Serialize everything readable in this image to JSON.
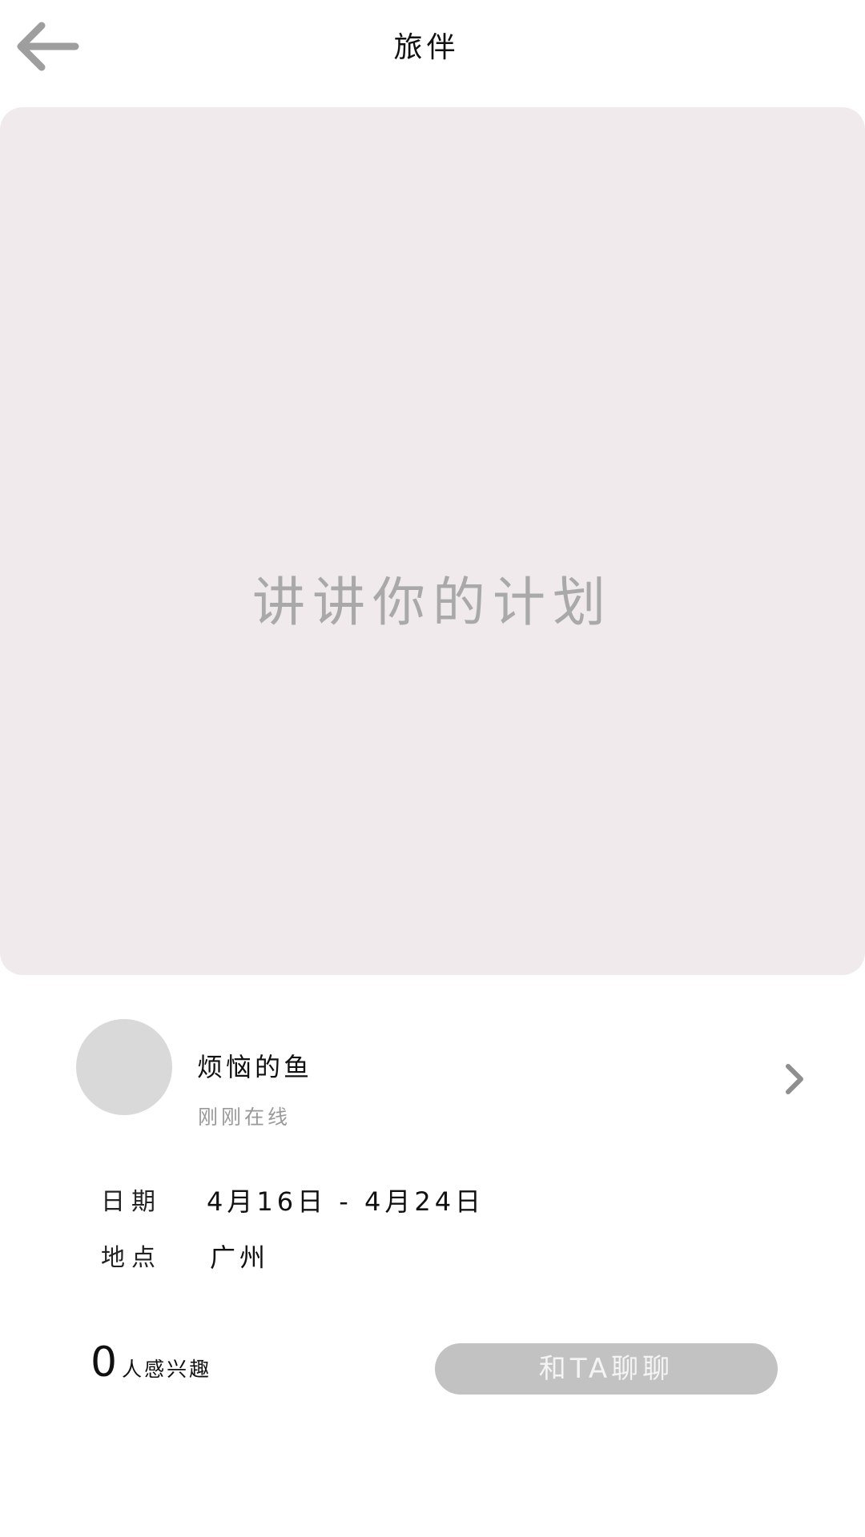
{
  "header": {
    "back_icon": "arrow-left-icon",
    "title": "旅伴"
  },
  "plan": {
    "placeholder": "讲讲你的计划",
    "background_color": "#f0eaec"
  },
  "profile": {
    "username": "烦恼的鱼",
    "status": "刚刚在线",
    "chevron_icon": "chevron-right-icon"
  },
  "trip": {
    "date_label": "日期",
    "date_value": "4月16日 - 4月24日",
    "location_label": "地点",
    "location_value": "广州"
  },
  "interest": {
    "count": "0",
    "label": "人感兴趣"
  },
  "actions": {
    "chat_label": "和TA聊聊",
    "chat_button_color": "#c2c2c2"
  }
}
